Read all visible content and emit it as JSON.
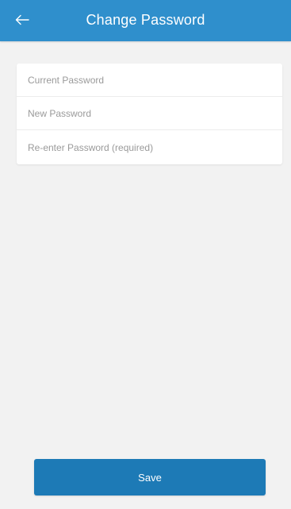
{
  "header": {
    "title": "Change Password",
    "back_icon": "arrow-left-icon"
  },
  "form": {
    "fields": [
      {
        "placeholder": "Current Password",
        "value": ""
      },
      {
        "placeholder": "New Password",
        "value": ""
      },
      {
        "placeholder": "Re-enter Password (required)",
        "value": ""
      }
    ]
  },
  "footer": {
    "save_label": "Save"
  },
  "colors": {
    "app_bar": "#2f8fcc",
    "button": "#1d7ab6",
    "background": "#f2f2f2",
    "card": "#ffffff"
  }
}
